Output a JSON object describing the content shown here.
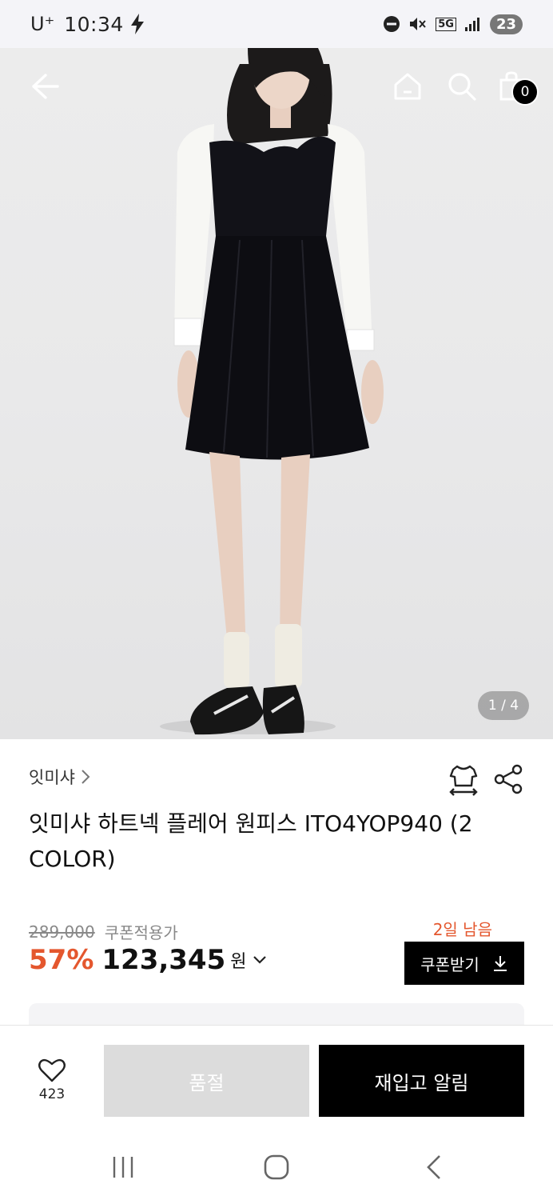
{
  "status_bar": {
    "carrier": "U⁺",
    "time": "10:34",
    "network": "5G",
    "battery": "23"
  },
  "hero": {
    "page_indicator": "1 / 4",
    "cart_count": "0"
  },
  "product": {
    "brand": "잇미샤",
    "title": "잇미샤 하트넥 플레어 원피스 ITO4YOP940 (2 COLOR)",
    "original_price": "289,000",
    "coupon_applied_label": "쿠폰적용가",
    "days_left": "2일 남음",
    "discount": "57%",
    "price": "123,345",
    "currency": "원",
    "coupon_button": "쿠폰받기"
  },
  "action_bar": {
    "wish_count": "423",
    "soldout_label": "품절",
    "restock_label": "재입고 알림"
  },
  "colors": {
    "accent": "#e4572e",
    "primary_button": "#000000",
    "disabled_button": "#dcdcdc"
  }
}
